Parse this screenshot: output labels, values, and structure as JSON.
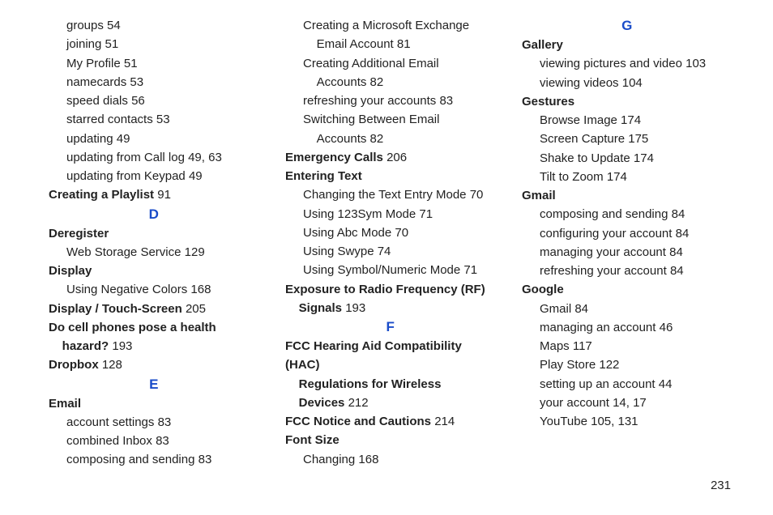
{
  "page_number": "231",
  "col1": [
    {
      "type": "sub",
      "text": "groups",
      "page": "54"
    },
    {
      "type": "sub",
      "text": "joining",
      "page": "51"
    },
    {
      "type": "sub",
      "text": "My Profile",
      "page": "51"
    },
    {
      "type": "sub",
      "text": "namecards",
      "page": "53"
    },
    {
      "type": "sub",
      "text": "speed dials",
      "page": "56"
    },
    {
      "type": "sub",
      "text": "starred contacts",
      "page": "53"
    },
    {
      "type": "sub",
      "text": "updating",
      "page": "49"
    },
    {
      "type": "sub",
      "text": "updating from Call log",
      "pages": [
        "49",
        "63"
      ]
    },
    {
      "type": "sub",
      "text": "updating from Keypad",
      "page": "49"
    },
    {
      "type": "bold",
      "text": "Creating a Playlist",
      "page": "91"
    },
    {
      "type": "letter",
      "text": "D"
    },
    {
      "type": "bold",
      "text": "Deregister"
    },
    {
      "type": "sub",
      "text": "Web Storage Service",
      "page": "129"
    },
    {
      "type": "bold",
      "text": "Display"
    },
    {
      "type": "sub",
      "text": "Using Negative Colors",
      "page": "168"
    },
    {
      "type": "bold",
      "text": "Display / Touch-Screen",
      "page": "205"
    },
    {
      "type": "bold-multiline",
      "lines": [
        "Do cell phones pose a health",
        "    hazard?"
      ],
      "page": "193"
    },
    {
      "type": "bold",
      "text": "Dropbox",
      "page": "128"
    },
    {
      "type": "letter",
      "text": "E"
    },
    {
      "type": "bold",
      "text": "Email"
    },
    {
      "type": "sub",
      "text": "account settings",
      "page": "83"
    },
    {
      "type": "sub",
      "text": "combined Inbox",
      "page": "83"
    },
    {
      "type": "sub",
      "text": "composing and sending",
      "page": "83"
    }
  ],
  "col2": [
    {
      "type": "sub-multiline",
      "lines": [
        "Creating a Microsoft Exchange",
        "    Email Account"
      ],
      "page": "81"
    },
    {
      "type": "sub-multiline",
      "lines": [
        "Creating Additional Email",
        "    Accounts"
      ],
      "page": "82"
    },
    {
      "type": "sub",
      "text": "refreshing your accounts",
      "page": "83"
    },
    {
      "type": "sub-multiline",
      "lines": [
        "Switching Between Email",
        "    Accounts"
      ],
      "page": "82"
    },
    {
      "type": "bold",
      "text": "Emergency Calls",
      "page": "206"
    },
    {
      "type": "bold",
      "text": "Entering Text"
    },
    {
      "type": "sub",
      "text": "Changing the Text Entry Mode",
      "page": "70"
    },
    {
      "type": "sub",
      "text": "Using 123Sym Mode",
      "page": "71"
    },
    {
      "type": "sub",
      "text": "Using Abc Mode",
      "page": "70"
    },
    {
      "type": "sub",
      "text": "Using Swype",
      "page": "74"
    },
    {
      "type": "sub",
      "text": "Using Symbol/Numeric Mode",
      "page": "71"
    },
    {
      "type": "bold-multiline",
      "lines": [
        "Exposure to Radio Frequency (RF)",
        "    Signals"
      ],
      "page": "193"
    },
    {
      "type": "letter",
      "text": "F"
    },
    {
      "type": "bold-multiline",
      "lines": [
        "FCC Hearing Aid Compatibility (HAC)",
        "    Regulations for Wireless",
        "    Devices"
      ],
      "page": "212"
    },
    {
      "type": "bold",
      "text": "FCC Notice and Cautions",
      "page": "214"
    },
    {
      "type": "bold",
      "text": "Font Size"
    },
    {
      "type": "sub",
      "text": "Changing",
      "page": "168"
    }
  ],
  "col3": [
    {
      "type": "letter",
      "text": "G"
    },
    {
      "type": "bold",
      "text": "Gallery"
    },
    {
      "type": "sub",
      "text": "viewing pictures and video",
      "page": "103"
    },
    {
      "type": "sub",
      "text": "viewing videos",
      "page": "104"
    },
    {
      "type": "bold",
      "text": "Gestures"
    },
    {
      "type": "sub",
      "text": "Browse Image",
      "page": "174"
    },
    {
      "type": "sub",
      "text": "Screen Capture",
      "page": "175"
    },
    {
      "type": "sub",
      "text": "Shake to Update",
      "page": "174"
    },
    {
      "type": "sub",
      "text": "Tilt to Zoom",
      "page": "174"
    },
    {
      "type": "bold",
      "text": "Gmail"
    },
    {
      "type": "sub",
      "text": "composing and sending",
      "page": "84"
    },
    {
      "type": "sub",
      "text": "configuring your account",
      "page": "84"
    },
    {
      "type": "sub",
      "text": "managing your account",
      "page": "84"
    },
    {
      "type": "sub",
      "text": "refreshing your account",
      "page": "84"
    },
    {
      "type": "bold",
      "text": "Google"
    },
    {
      "type": "sub",
      "text": "Gmail",
      "page": "84"
    },
    {
      "type": "sub",
      "text": "managing an account",
      "page": "46"
    },
    {
      "type": "sub",
      "text": "Maps",
      "page": "117"
    },
    {
      "type": "sub",
      "text": "Play Store",
      "page": "122"
    },
    {
      "type": "sub",
      "text": "setting up an account",
      "page": "44"
    },
    {
      "type": "sub",
      "text": "your account",
      "pages": [
        "14",
        "17"
      ]
    },
    {
      "type": "sub",
      "text": "YouTube",
      "pages": [
        "105",
        "131"
      ]
    }
  ]
}
